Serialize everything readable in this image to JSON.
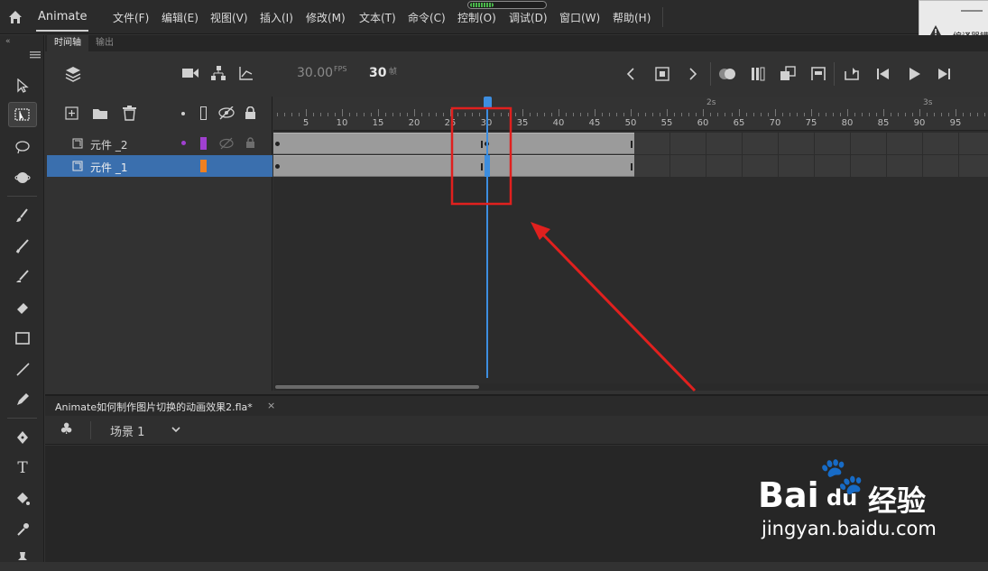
{
  "menubar": {
    "app_name": "Animate",
    "items": [
      "文件(F)",
      "编辑(E)",
      "视图(V)",
      "插入(I)",
      "修改(M)",
      "文本(T)",
      "命令(C)",
      "控制(O)",
      "调试(D)",
      "窗口(W)",
      "帮助(H)"
    ],
    "alert_text": "编译器错"
  },
  "tabs": {
    "timeline": "时间轴",
    "output": "输出"
  },
  "timeline": {
    "fps": "30.00",
    "fps_unit": "FPS",
    "current_frame": "30",
    "frame_unit": "帧",
    "ruler_ticks": [
      "5",
      "10",
      "15",
      "20",
      "25",
      "30",
      "35",
      "40",
      "45",
      "50",
      "55",
      "60",
      "65",
      "70",
      "75",
      "80",
      "85",
      "90",
      "95"
    ],
    "seconds": [
      "2s",
      "3s"
    ],
    "playhead_frame": 30,
    "layers": [
      {
        "name": "元件 _2",
        "color": "#a040d0",
        "span_end": 50,
        "keyframes": [
          1,
          30
        ]
      },
      {
        "name": "元件 _1",
        "color": "#f08020",
        "span_end": 50,
        "keyframes": [
          1,
          30
        ],
        "selected": true
      }
    ]
  },
  "document": {
    "tab_title": "Animate如何制作图片切换的动画效果2.fla*",
    "scene_label": "场景 1"
  },
  "watermark": {
    "brand": "Bai",
    "brand2": "du",
    "cn": "经验",
    "url": "jingyan.baidu.com"
  },
  "colors": {
    "accent": "#3a6fae",
    "playhead": "#3d8ee0",
    "annotation": "#e0201e"
  }
}
